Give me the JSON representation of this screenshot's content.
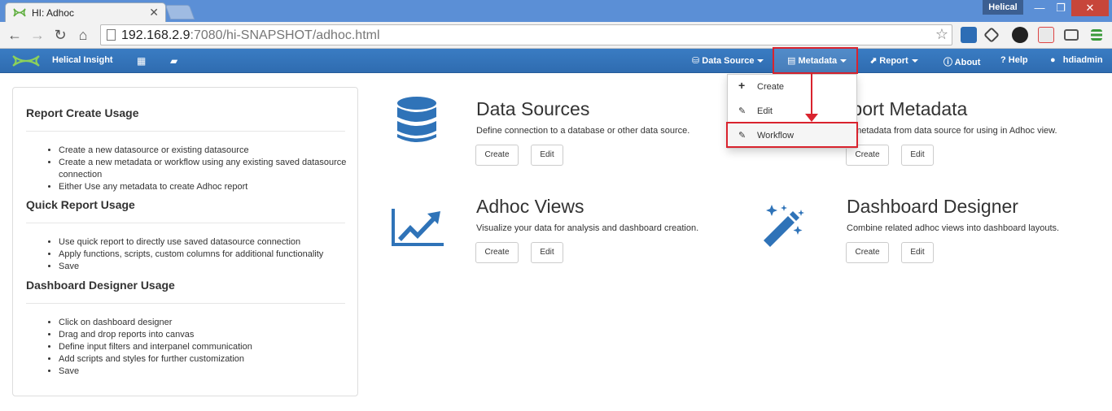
{
  "browser": {
    "tab_title": "HI: Adhoc",
    "tab_close": "✕",
    "user_badge": "Helical",
    "url_host": "192.168.2.9",
    "url_rest": ":7080/hi-SNAPSHOT/adhoc.html",
    "controls": {
      "minimize": "—",
      "maximize": "❐",
      "close": "✕"
    }
  },
  "navbar": {
    "brand": "Helical Insight",
    "items": {
      "data_source": "Data Source",
      "metadata": "Metadata",
      "report": "Report",
      "about": "About",
      "help": "Help",
      "user": "hdiadmin"
    }
  },
  "dropdown": {
    "items": [
      {
        "icon": "plus-icon",
        "label": "Create"
      },
      {
        "icon": "pencil-icon",
        "label": "Edit"
      },
      {
        "icon": "pencil-icon",
        "label": "Workflow"
      }
    ]
  },
  "panel": {
    "sections": [
      {
        "title": "Report Create Usage",
        "items": [
          "Create a new datasource or existing datasource",
          "Create a new metadata or workflow using any existing saved datasource connection",
          "Either Use any metadata to create Adhoc report"
        ]
      },
      {
        "title": "Quick Report Usage",
        "items": [
          "Use quick report to directly use saved datasource connection",
          "Apply functions, scripts, custom columns for additional functionality",
          "Save"
        ]
      },
      {
        "title": "Dashboard Designer Usage",
        "items": [
          "Click on dashboard designer",
          "Drag and drop reports into canvas",
          "Define input filters and interpanel communication",
          "Add scripts and styles for further customization",
          "Save"
        ]
      }
    ]
  },
  "cards": [
    {
      "title": "Data Sources",
      "desc": "Define connection to a database or other data source.",
      "create": "Create",
      "edit": "Edit",
      "icon": "database-icon"
    },
    {
      "title": "Report Metadata",
      "desc": "Create metadata from data source for using in Adhoc view.",
      "create": "Create",
      "edit": "Edit",
      "icon": ""
    },
    {
      "title": "Adhoc Views",
      "desc": "Visualize your data for analysis and dashboard creation.",
      "create": "Create",
      "edit": "Edit",
      "icon": "line-chart-icon"
    },
    {
      "title": "Dashboard Designer",
      "desc": "Combine related adhoc views into dashboard layouts.",
      "create": "Create",
      "edit": "Edit",
      "icon": "magic-wand-icon"
    }
  ],
  "colors": {
    "navbar": "#3a7cc3",
    "accent": "#2f6cb0",
    "highlight": "#d9232e",
    "icon_blue": "#2f73b8"
  }
}
